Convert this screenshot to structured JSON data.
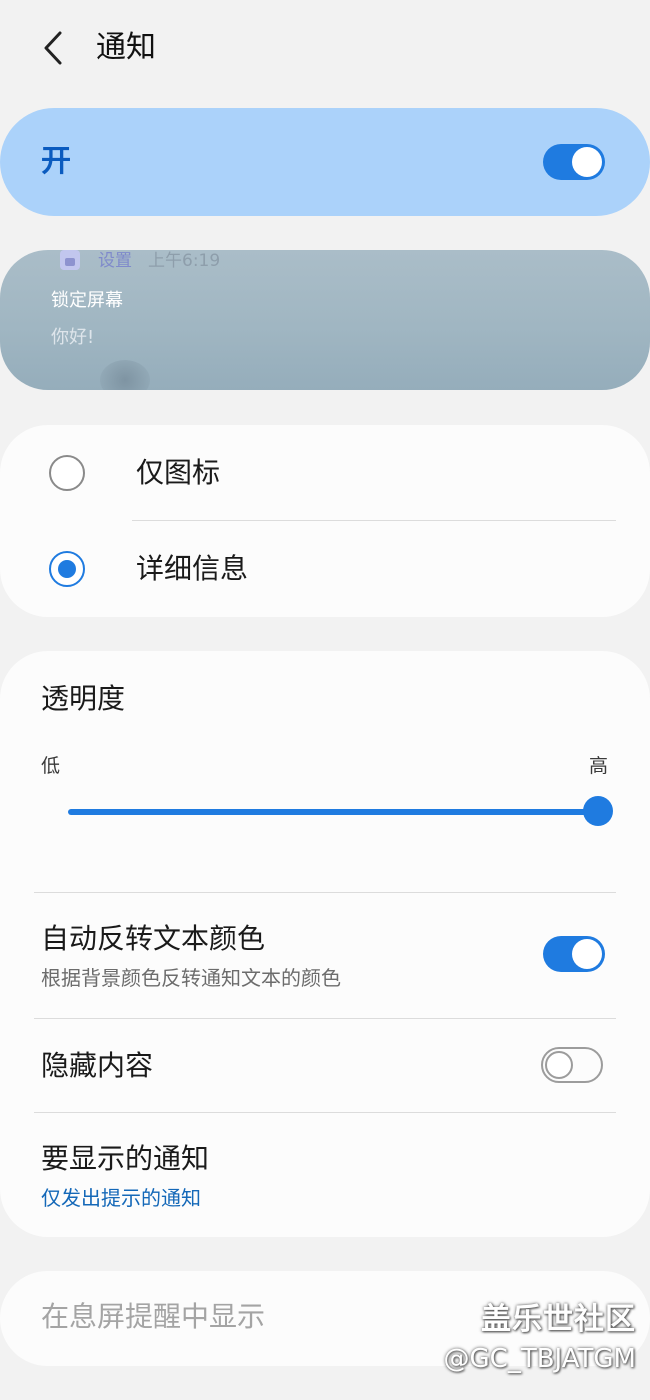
{
  "header": {
    "title": "通知"
  },
  "master_switch": {
    "label": "开",
    "state": "on"
  },
  "preview": {
    "app_name": "设置",
    "time": "上午6:19",
    "title": "锁定屏幕",
    "body": "你好!"
  },
  "display_style": {
    "options": [
      {
        "label": "仅图标",
        "selected": false
      },
      {
        "label": "详细信息",
        "selected": true
      }
    ]
  },
  "transparency": {
    "title": "透明度",
    "min_label": "低",
    "max_label": "高",
    "level_percent": 100
  },
  "settings": {
    "auto_invert": {
      "title": "自动反转文本颜色",
      "subtitle": "根据背景颜色反转通知文本的颜色",
      "state": "on"
    },
    "hide_content": {
      "title": "隐藏内容",
      "state": "off"
    },
    "notifications_to_show": {
      "title": "要显示的通知",
      "value": "仅发出提示的通知"
    }
  },
  "aod": {
    "label": "在息屏提醒中显示"
  },
  "watermark": {
    "brand": "盖乐世社区",
    "handle": "@GC_TBJATGM"
  },
  "colors": {
    "accent": "#1f7be0",
    "master_bg": "#abd2fa",
    "link": "#1468b8",
    "background": "#f2f2f2"
  }
}
